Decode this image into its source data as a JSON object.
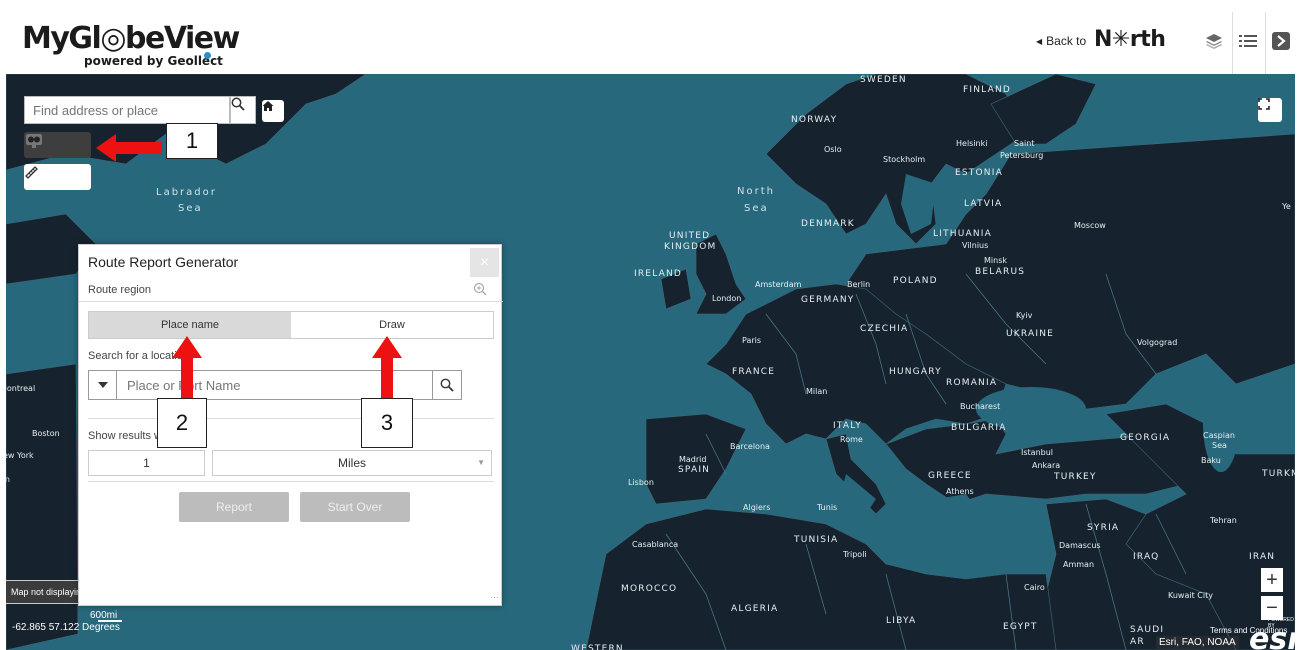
{
  "header": {
    "logo_text": "MyGl◎beView",
    "logo_sub": "powered by Geollect",
    "back_to": "Back to",
    "north_logo": "N✳rth"
  },
  "map_controls": {
    "search_placeholder": "Find address or place",
    "coordinates": "-62.865 57.122 Degrees",
    "scale_label": "600mi",
    "map_notice": "Map not displaying",
    "attribution": "Esri, FAO, NOAA",
    "esri": "esri",
    "terms": "Terms and Conditions",
    "powered_by_esri": "POWERED BY",
    "zoom_in": "+",
    "zoom_out": "−"
  },
  "map_labels": [
    {
      "text": "SWEDEN",
      "k": "c"
    },
    {
      "text": "FINLAND",
      "k": "c"
    },
    {
      "text": "NORWAY",
      "k": "c"
    },
    {
      "text": "Oslo",
      "k": "t"
    },
    {
      "text": "Stockholm",
      "k": "t"
    },
    {
      "text": "Helsinki",
      "k": "t"
    },
    {
      "text": "Saint",
      "k": "t"
    },
    {
      "text": "Petersburg",
      "k": "t"
    },
    {
      "text": "ESTONIA",
      "k": "c"
    },
    {
      "text": "North",
      "k": "s"
    },
    {
      "text": "Sea",
      "k": "s"
    },
    {
      "text": "Labrador",
      "k": "s"
    },
    {
      "text": "Sea",
      "k": "s"
    },
    {
      "text": "LATVIA",
      "k": "c"
    },
    {
      "text": "DENMARK",
      "k": "c"
    },
    {
      "text": "LITHUANIA",
      "k": "c"
    },
    {
      "text": "Vilnius",
      "k": "t"
    },
    {
      "text": "Minsk",
      "k": "t"
    },
    {
      "text": "BELARUS",
      "k": "c"
    },
    {
      "text": "Moscow",
      "k": "t"
    },
    {
      "text": "UNITED",
      "k": "c"
    },
    {
      "text": "KINGDOM",
      "k": "c"
    },
    {
      "text": "IRELAND",
      "k": "c"
    },
    {
      "text": "Amsterdam",
      "k": "t"
    },
    {
      "text": "Berlin",
      "k": "t"
    },
    {
      "text": "POLAND",
      "k": "c"
    },
    {
      "text": "London",
      "k": "t"
    },
    {
      "text": "GERMANY",
      "k": "c"
    },
    {
      "text": "Kyiv",
      "k": "t"
    },
    {
      "text": "UKRAINE",
      "k": "c"
    },
    {
      "text": "CZECHIA",
      "k": "c"
    },
    {
      "text": "Paris",
      "k": "t"
    },
    {
      "text": "Volgograd",
      "k": "t"
    },
    {
      "text": "FRANCE",
      "k": "c"
    },
    {
      "text": "HUNGARY",
      "k": "c"
    },
    {
      "text": "ROMANIA",
      "k": "c"
    },
    {
      "text": "Milan",
      "k": "t"
    },
    {
      "text": "Bucharest",
      "k": "t"
    },
    {
      "text": "ITALY",
      "k": "c"
    },
    {
      "text": "BULGARIA",
      "k": "c"
    },
    {
      "text": "Rome",
      "k": "t"
    },
    {
      "text": "GEORGIA",
      "k": "c"
    },
    {
      "text": "Caspian",
      "k": "t"
    },
    {
      "text": "Sea",
      "k": "t"
    },
    {
      "text": "Madrid",
      "k": "t"
    },
    {
      "text": "SPAIN",
      "k": "c"
    },
    {
      "text": "Barcelona",
      "k": "t"
    },
    {
      "text": "Istanbul",
      "k": "t"
    },
    {
      "text": "Baku",
      "k": "t"
    },
    {
      "text": "Ankara",
      "k": "t"
    },
    {
      "text": "GREECE",
      "k": "c"
    },
    {
      "text": "TURKEY",
      "k": "c"
    },
    {
      "text": "TURKM",
      "k": "c"
    },
    {
      "text": "Athens",
      "k": "t"
    },
    {
      "text": "Lisbon",
      "k": "t"
    },
    {
      "text": "Algiers",
      "k": "t"
    },
    {
      "text": "Tunis",
      "k": "t"
    },
    {
      "text": "Tehran",
      "k": "t"
    },
    {
      "text": "SYRIA",
      "k": "c"
    },
    {
      "text": "TUNISIA",
      "k": "c"
    },
    {
      "text": "Casablanca",
      "k": "t"
    },
    {
      "text": "Tripoli",
      "k": "t"
    },
    {
      "text": "Damascus",
      "k": "t"
    },
    {
      "text": "IRAQ",
      "k": "c"
    },
    {
      "text": "IRAN",
      "k": "c"
    },
    {
      "text": "Amman",
      "k": "t"
    },
    {
      "text": "MOROCCO",
      "k": "c"
    },
    {
      "text": "Cairo",
      "k": "t"
    },
    {
      "text": "Kuwait City",
      "k": "t"
    },
    {
      "text": "ALGERIA",
      "k": "c"
    },
    {
      "text": "LIBYA",
      "k": "c"
    },
    {
      "text": "EGYPT",
      "k": "c"
    },
    {
      "text": "SAUDI",
      "k": "c"
    },
    {
      "text": "AR",
      "k": "c"
    },
    {
      "text": "WESTERN",
      "k": "c"
    },
    {
      "text": "Montreal",
      "k": "t"
    },
    {
      "text": "Boston",
      "k": "t"
    },
    {
      "text": "ew York",
      "k": "t"
    },
    {
      "text": "Ye",
      "k": "t"
    },
    {
      "text": "on",
      "k": "t"
    }
  ],
  "panel": {
    "title": "Route Report Generator",
    "close": "×",
    "region_label": "Route region",
    "tabs": [
      "Place name",
      "Draw"
    ],
    "search_label": "Search for a location",
    "place_placeholder": "Place or Port Name",
    "results_label": "Show results within",
    "distance_value": "1",
    "unit_value": "Miles",
    "report_button": "Report",
    "start_over_button": "Start Over"
  },
  "callouts": [
    "1",
    "2",
    "3"
  ],
  "colors": {
    "water": "#27687c",
    "land": "#16232e",
    "accent_red": "#ee1111"
  }
}
